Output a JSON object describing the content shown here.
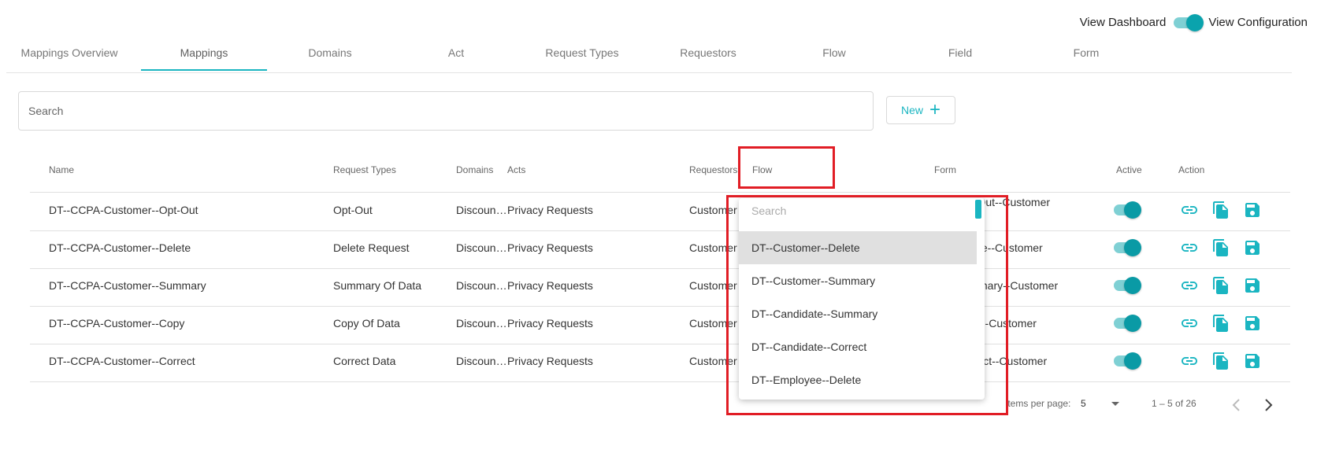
{
  "view_toggle": {
    "left_label": "View Dashboard",
    "right_label": "View Configuration"
  },
  "tabs": [
    {
      "label": "Mappings Overview"
    },
    {
      "label": "Mappings",
      "active": true
    },
    {
      "label": "Domains"
    },
    {
      "label": "Act"
    },
    {
      "label": "Request Types"
    },
    {
      "label": "Requestors"
    },
    {
      "label": "Flow"
    },
    {
      "label": "Field"
    },
    {
      "label": "Form"
    }
  ],
  "search": {
    "placeholder": "Search"
  },
  "new_button": {
    "label": "New"
  },
  "table": {
    "headers": {
      "name": "Name",
      "request_types": "Request Types",
      "domains": "Domains",
      "acts": "Acts",
      "requestors": "Requestors",
      "flow": "Flow",
      "form": "Form",
      "active": "Active",
      "action": "Action"
    },
    "rows": [
      {
        "name": "DT--CCPA-Customer--Opt-Out",
        "request_type": "Opt-Out",
        "domain": "Discoun…",
        "act": "Privacy Requests",
        "requestor": "Customer",
        "form": "DT--Opt-Out--Customer",
        "active": true
      },
      {
        "name": "DT--CCPA-Customer--Delete",
        "request_type": "Delete Request",
        "domain": "Discoun…",
        "act": "Privacy Requests",
        "requestor": "Customer",
        "form": "DT--Delete--Customer",
        "active": true
      },
      {
        "name": "DT--CCPA-Customer--Summary",
        "request_type": "Summary Of Data",
        "domain": "Discoun…",
        "act": "Privacy Requests",
        "requestor": "Customer",
        "form": "DT--Summary--Customer",
        "active": true
      },
      {
        "name": "DT--CCPA-Customer--Copy",
        "request_type": "Copy Of Data",
        "domain": "Discoun…",
        "act": "Privacy Requests",
        "requestor": "Customer",
        "form": "DT--Copy--Customer",
        "active": true
      },
      {
        "name": "DT--CCPA-Customer--Correct",
        "request_type": "Correct Data",
        "domain": "Discoun…",
        "act": "Privacy Requests",
        "requestor": "Customer",
        "form": "DT--Correct--Customer",
        "active": true
      }
    ]
  },
  "flow_dropdown": {
    "search_placeholder": "Search",
    "options": [
      {
        "label": "DT--Customer--Delete",
        "selected": true
      },
      {
        "label": "DT--Customer--Summary"
      },
      {
        "label": "DT--Candidate--Summary"
      },
      {
        "label": "DT--Candidate--Correct"
      },
      {
        "label": "DT--Employee--Delete"
      }
    ]
  },
  "paginator": {
    "items_per_page_label": "Items per page:",
    "page_size": "5",
    "range": "1 – 5 of 26"
  },
  "colors": {
    "accent": "#1ab5c1",
    "toggle_knob": "#0a9aa5",
    "highlight": "#e11d25"
  }
}
